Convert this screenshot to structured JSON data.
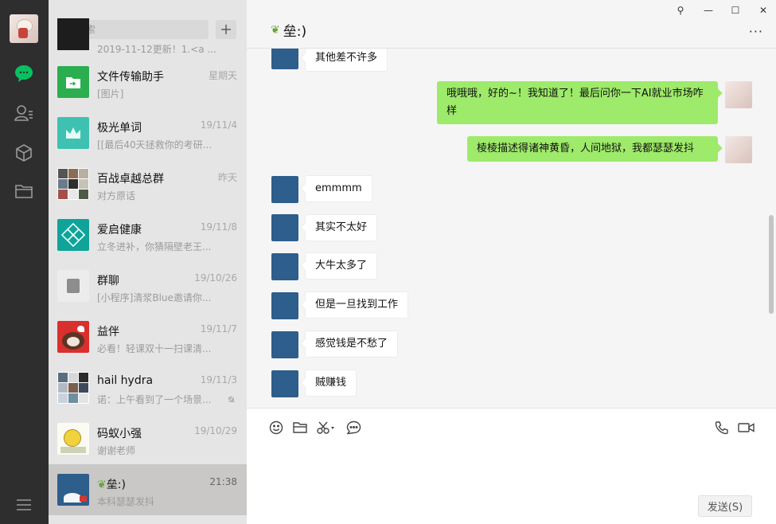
{
  "app": {
    "title_buttons": {
      "pin": "⚲",
      "minimize": "—",
      "maximize": "☐",
      "close": "✕"
    }
  },
  "rail": {
    "items": [
      {
        "icon": "chat-icon",
        "active": true
      },
      {
        "icon": "contacts-icon",
        "active": false
      },
      {
        "icon": "cube-icon",
        "active": false
      },
      {
        "icon": "folder-icon",
        "active": false
      }
    ],
    "menu_icon": "menu-icon"
  },
  "search": {
    "placeholder": "搜索"
  },
  "chats": [
    {
      "name": "",
      "time": "",
      "preview": "2019-11-12更新！1.<a ..."
    },
    {
      "name": "文件传输助手",
      "time": "星期天",
      "preview": "[图片]"
    },
    {
      "name": "极光单词",
      "time": "19/11/4",
      "preview": "[[最后40天拯救你的考研..."
    },
    {
      "name": "百战卓越总群",
      "time": "昨天",
      "preview": "对方原话"
    },
    {
      "name": "爱启健康",
      "time": "19/11/8",
      "preview": "立冬进补，你猜隔壁老王..."
    },
    {
      "name": "群聊",
      "time": "19/10/26",
      "preview": "[小程序]清浆Blue邀请你..."
    },
    {
      "name": "益伴",
      "time": "19/11/7",
      "preview": "必看！轻课双十一扫课清..."
    },
    {
      "name": "hail hydra",
      "time": "19/11/3",
      "preview": "诺：上午看到了一个场景..."
    },
    {
      "name": "码蚁小强",
      "time": "19/10/29",
      "preview": "谢谢老师"
    },
    {
      "name": "垒:)",
      "time": "21:38",
      "preview": "本科瑟瑟发抖"
    }
  ],
  "chat": {
    "title": "垒:)",
    "more": "···",
    "messages": [
      {
        "dir": "in",
        "text": "其他差不许多"
      },
      {
        "dir": "out",
        "text": "哦哦哦，好的~！我知道了！最后问你一下AI就业市场咋样"
      },
      {
        "dir": "out",
        "text": "棱棱描述得诸神黄昏，人间地狱，我都瑟瑟发抖"
      },
      {
        "dir": "in",
        "text": "emmmm"
      },
      {
        "dir": "in",
        "text": "其实不太好"
      },
      {
        "dir": "in",
        "text": "大牛太多了"
      },
      {
        "dir": "in",
        "text": "但是一旦找到工作"
      },
      {
        "dir": "in",
        "text": "感觉钱是不愁了"
      },
      {
        "dir": "in",
        "text": "贼赚钱"
      }
    ]
  },
  "composer": {
    "tools": [
      "emoji-icon",
      "folder-icon",
      "scissors-icon",
      "chat-bubble-icon",
      "phone-icon",
      "video-icon"
    ],
    "send_label": "发送(S)"
  }
}
